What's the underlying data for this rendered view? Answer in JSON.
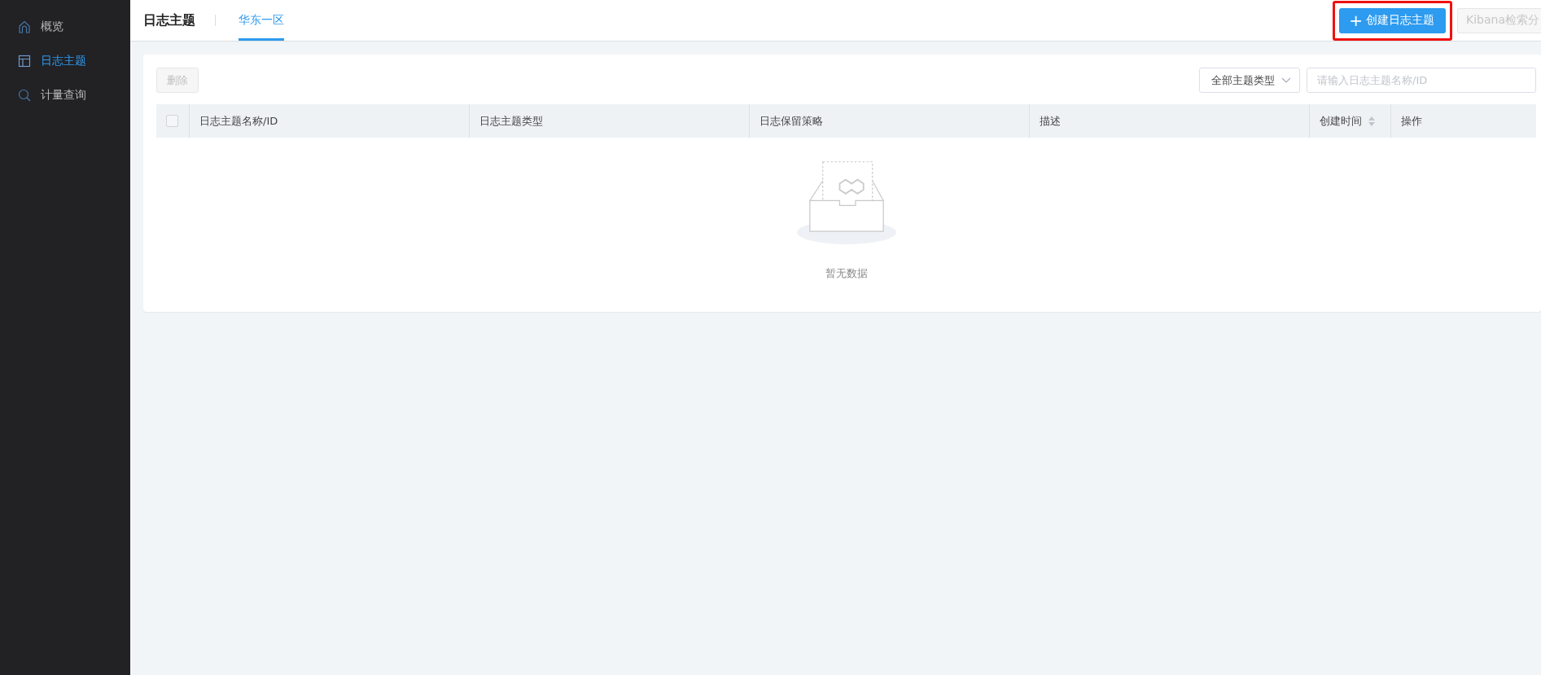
{
  "sidebar": {
    "items": [
      {
        "label": "概览",
        "selected": false
      },
      {
        "label": "日志主题",
        "selected": true
      },
      {
        "label": "计量查询",
        "selected": false
      }
    ]
  },
  "header": {
    "title": "日志主题",
    "tabs": [
      {
        "label": "华东一区",
        "selected": true
      }
    ],
    "create_button": {
      "icon": "+",
      "label": "创建日志主题",
      "highlighted": true
    },
    "kibana_button": {
      "label": "Kibana检索分",
      "disabled": true
    }
  },
  "toolbar": {
    "delete_button": {
      "label": "删除",
      "disabled": true
    },
    "type_filter": {
      "value": "全部主题类型"
    },
    "search": {
      "placeholder": "请输入日志主题名称/ID"
    }
  },
  "table": {
    "select_all": {
      "checked": false
    },
    "columns": [
      {
        "label": "日志主题名称/ID",
        "sortable": false
      },
      {
        "label": "日志主题类型",
        "sortable": false
      },
      {
        "label": "日志保留策略",
        "sortable": false
      },
      {
        "label": "描述",
        "sortable": false
      },
      {
        "label": "创建时间",
        "sortable": true
      },
      {
        "label": "操作",
        "sortable": false
      }
    ],
    "empty_text": "暂无数据"
  }
}
